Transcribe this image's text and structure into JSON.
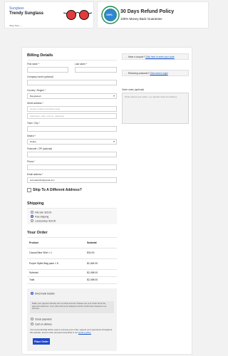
{
  "promos": {
    "left": {
      "tag": "Sunglass",
      "name": "Trendy Sunglass",
      "link": "Shop Now →"
    },
    "right": {
      "badge": "100%",
      "title": "30 Days Refund Policy",
      "subtitle": "100% Money Back Guarantee"
    }
  },
  "billing": {
    "heading": "Billing Details",
    "first_name_label": "First name *",
    "last_name_label": "Last name *",
    "company_label": "Company name (optional)",
    "country_label": "Country / Region *",
    "country_value": "Bangladesh",
    "street_label": "Street address *",
    "street_placeholder": "House number and street name",
    "street2_placeholder": "Apartment, suite, unit etc. (optional)",
    "town_label": "Town / City *",
    "district_label": "District *",
    "district_value": "Dhaka",
    "postcode_label": "Postcode / ZIP (optional)",
    "phone_label": "Phone *",
    "email_label": "Email address *",
    "email_value": "testmailer021@gmail.com"
  },
  "sidebar": {
    "coupon_text": "Have a coupon?",
    "coupon_link": "Click here to enter your code",
    "returning_text": "Returning customer?",
    "returning_link": "Click here to login",
    "notes_label": "Order notes (optional)",
    "notes_placeholder": "Notes about your order, e.g. special notes for delivery."
  },
  "ship_different": {
    "label": "Ship To A Different Address?"
  },
  "shipping": {
    "heading": "Shipping",
    "options": [
      {
        "label": "Flat rate: $15.00",
        "selected": false
      },
      {
        "label": "Free shipping",
        "selected": true
      },
      {
        "label": "Local pickup: $13.00",
        "selected": false
      }
    ]
  },
  "order": {
    "heading": "Your Order",
    "col_product": "Product",
    "col_subtotal": "Subtotal",
    "items": [
      {
        "name": "Casual Blue Shirt × 1",
        "subtotal": "$34.00"
      },
      {
        "name": "Purple Stylist Bag pack × 8",
        "subtotal": "$2,464.00"
      }
    ],
    "subtotal_label": "Subtotal",
    "subtotal_value": "$2,498.00",
    "total_label": "Total",
    "total_value": "$2,498.00"
  },
  "payment": {
    "bank_label": "Direct bank transfer",
    "bank_desc": "Make your payment directly into our bank account. Please use your Order ID as the payment reference. Your order will not be shipped until the funds have cleared in our account.",
    "check_label": "Check payments",
    "cod_label": "Cash on delivery",
    "privacy_text": "Your personal data will be used to process your order, support your experience throughout this website, and for other purposes described in our",
    "privacy_link": "privacy policy.",
    "place_order": "Place Order"
  },
  "colors": {
    "accent": "#2148c9",
    "link": "#1a57c4"
  }
}
